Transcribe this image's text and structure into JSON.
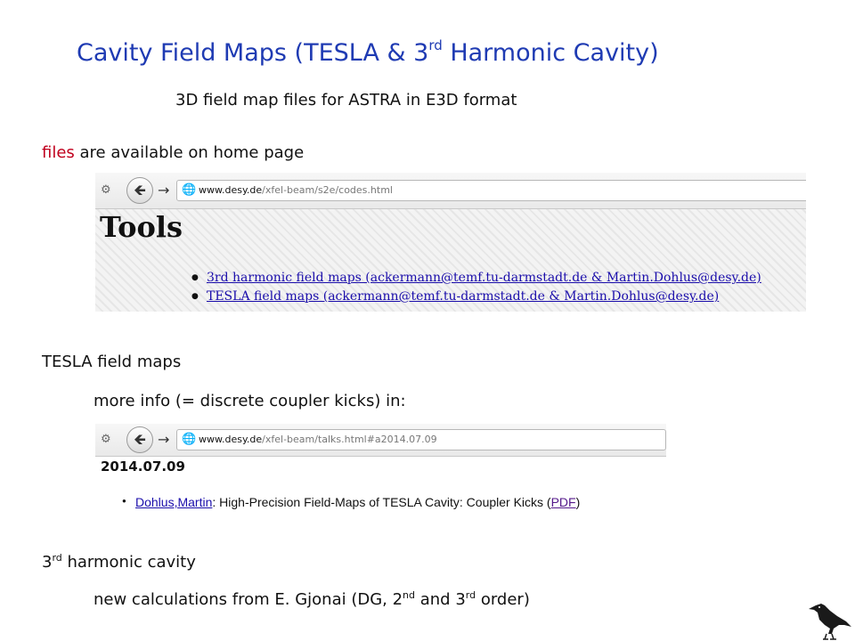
{
  "title": {
    "before": "Cavity Field Maps (TESLA & 3",
    "sup": "rd",
    "after": " Harmonic Cavity)"
  },
  "subtitle": "3D field map files for ASTRA in E3D format",
  "files_line": {
    "accent": "files",
    "rest": " are available on home page"
  },
  "screenshot1": {
    "url_domain": "www.desy.de",
    "url_path": "/xfel-beam/s2e/codes.html",
    "heading": "Tools",
    "links": [
      "3rd harmonic field maps (ackermann@temf.tu-darmstadt.de & Martin.Dohlus@desy.de)",
      "TESLA field maps (ackermann@temf.tu-darmstadt.de & Martin.Dohlus@desy.de)"
    ]
  },
  "tesla_heading": "TESLA field maps",
  "more_info": "more info (= discrete coupler kicks) in:",
  "screenshot2": {
    "url_domain": "www.desy.de",
    "url_path": "/xfel-beam/talks.html#a2014.07.09",
    "date": "2014.07.09",
    "author": "Dohlus,Martin",
    "talk_title": ": High-Precision Field-Maps of TESLA Cavity: Coupler Kicks (",
    "pdf": "PDF",
    "close": ")"
  },
  "third_heading": {
    "num": "3",
    "sup": "rd",
    "text": " harmonic cavity"
  },
  "new_calc": {
    "a": "new calculations from E. Gjonai (DG, 2",
    "sup1": "nd",
    "b": " and 3",
    "sup2": "rd",
    "c": " order)"
  },
  "icons": [
    "gear-icon",
    "back-arrow-icon",
    "forward-arrow-icon",
    "globe-icon",
    "raven-logo"
  ],
  "colors": {
    "title": "#1f3bb3",
    "accent": "#c0001d",
    "link": "#1a0dab",
    "visited": "#551a8b"
  }
}
